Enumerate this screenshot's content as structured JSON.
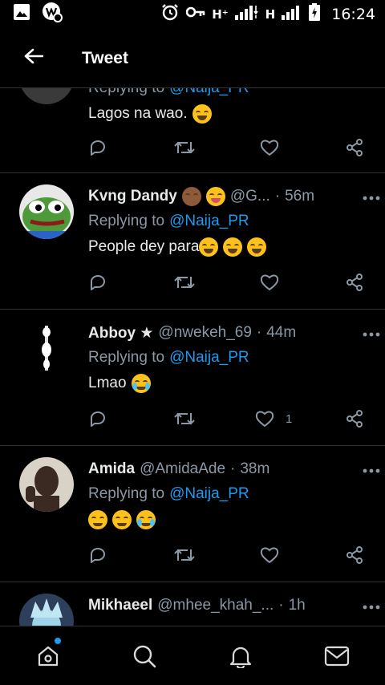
{
  "status_bar": {
    "net1": "H⁺",
    "net2": "H",
    "time": "16:24"
  },
  "header": {
    "title": "Tweet"
  },
  "tweets": [
    {
      "name": "",
      "handle": "",
      "time": "",
      "replying_prefix": "Replying to",
      "replying_to": "@Naija_PR",
      "text": "Lagos na wao.",
      "likes": ""
    },
    {
      "name": "Kvng Dandy",
      "handle": "@G...",
      "time": "56m",
      "replying_prefix": "Replying to",
      "replying_to": "@Naija_PR",
      "text": "People dey para",
      "likes": ""
    },
    {
      "name": "Abboy ★",
      "handle": "@nwekeh_69",
      "time": "44m",
      "replying_prefix": "Replying to",
      "replying_to": "@Naija_PR",
      "text": "Lmao",
      "likes": "1"
    },
    {
      "name": "Amida",
      "handle": "@AmidaAde",
      "time": "38m",
      "replying_prefix": "Replying to",
      "replying_to": "@Naija_PR",
      "text": "",
      "likes": ""
    },
    {
      "name": "Mikhaeel",
      "handle": "@mhee_khah_...",
      "time": "1h"
    }
  ],
  "icons": {
    "back": "arrow-left-icon",
    "reply": "reply-icon",
    "retweet": "retweet-icon",
    "like": "heart-icon",
    "share": "share-icon",
    "more": "more-icon",
    "nav": [
      "home-icon",
      "search-icon",
      "notifications-icon",
      "messages-icon"
    ]
  },
  "colors": {
    "accent": "#1d9bf0",
    "background": "#000000",
    "muted": "#8b98a5"
  }
}
